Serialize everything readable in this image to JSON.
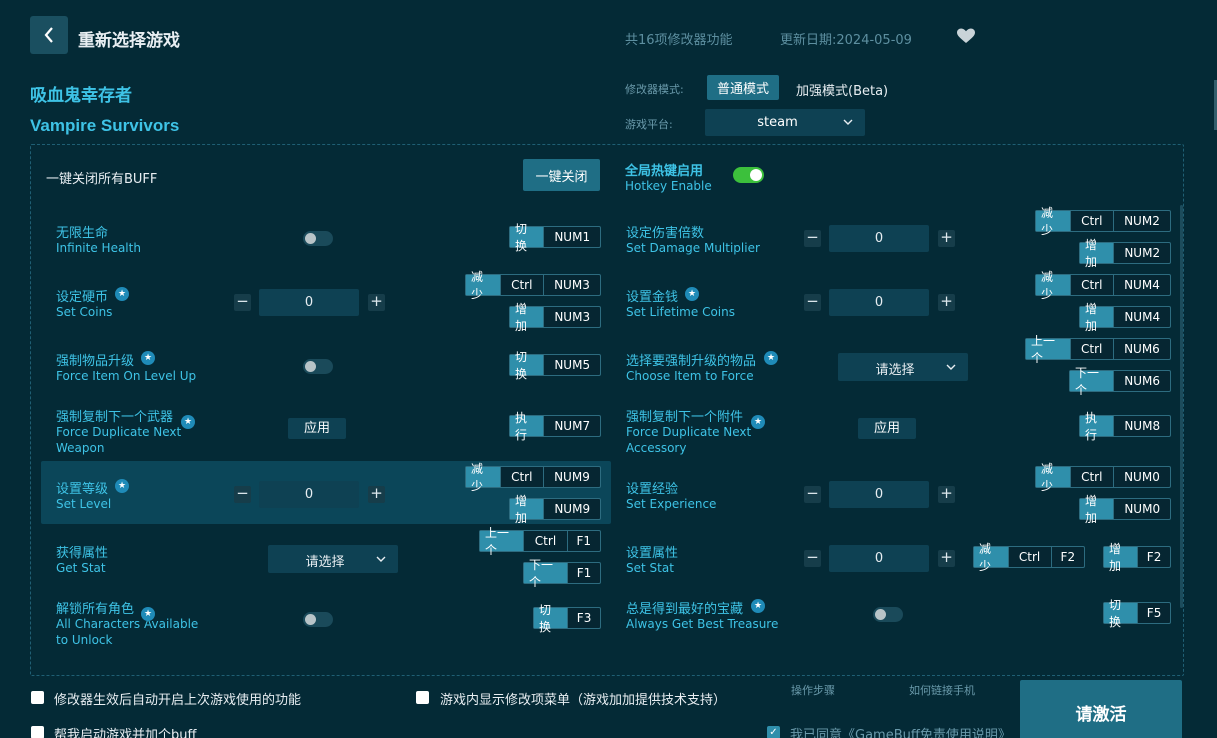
{
  "header": {
    "title": "重新选择游戏",
    "feature_count": "共16项修改器功能",
    "update_date": "更新日期:2024-05-09"
  },
  "game": {
    "name_cn": "吸血鬼幸存者",
    "name_en": "Vampire Survivors"
  },
  "mode": {
    "label": "修改器模式:",
    "normal": "普通模式",
    "strong": "加强模式(Beta)"
  },
  "platform": {
    "label": "游戏平台:",
    "value": "steam"
  },
  "panel": {
    "close_all_label": "一键关闭所有BUFF",
    "close_all_button": "一键关闭",
    "hotkey_cn": "全局热键启用",
    "hotkey_en": "Hotkey Enable"
  },
  "features": [
    {
      "cn": "无限生命",
      "en": "Infinite Health",
      "control": "toggle",
      "keys": [
        [
          "切换",
          "NUM1"
        ]
      ]
    },
    {
      "cn": "设定伤害倍数",
      "en": "Set Damage Multiplier",
      "control": "number",
      "value": "0",
      "keys": [
        [
          "减少",
          "Ctrl",
          "NUM2"
        ],
        [
          "增加",
          "NUM2"
        ]
      ]
    },
    {
      "cn": "设定硬币",
      "en": "Set Coins",
      "star": true,
      "control": "number",
      "value": "0",
      "keys": [
        [
          "减少",
          "Ctrl",
          "NUM3"
        ],
        [
          "增加",
          "NUM3"
        ]
      ]
    },
    {
      "cn": "设置金钱",
      "en": "Set Lifetime Coins",
      "star": true,
      "control": "number",
      "value": "0",
      "keys": [
        [
          "减少",
          "Ctrl",
          "NUM4"
        ],
        [
          "增加",
          "NUM4"
        ]
      ]
    },
    {
      "cn": "强制物品升级",
      "en": "Force Item On Level Up",
      "star": true,
      "control": "toggle",
      "keys": [
        [
          "切换",
          "NUM5"
        ]
      ]
    },
    {
      "cn": "选择要强制升级的物品",
      "en": "Choose Item to Force",
      "star": true,
      "control": "select",
      "value": "请选择",
      "keys": [
        [
          "上一个",
          "Ctrl",
          "NUM6"
        ],
        [
          "下一个",
          "NUM6"
        ]
      ]
    },
    {
      "cn": "强制复制下一个武器",
      "en": "Force Duplicate Next Weapon",
      "star": true,
      "control": "apply",
      "value": "应用",
      "keys": [
        [
          "执行",
          "NUM7"
        ]
      ]
    },
    {
      "cn": "强制复制下一个附件",
      "en": "Force Duplicate Next Accessory",
      "star": true,
      "control": "apply",
      "value": "应用",
      "keys": [
        [
          "执行",
          "NUM8"
        ]
      ]
    },
    {
      "cn": "设置等级",
      "en": "Set Level",
      "star": true,
      "control": "number",
      "value": "0",
      "keys": [
        [
          "减少",
          "Ctrl",
          "NUM9"
        ],
        [
          "增加",
          "NUM9"
        ]
      ]
    },
    {
      "cn": "设置经验",
      "en": "Set Experience",
      "control": "number",
      "value": "0",
      "keys": [
        [
          "减少",
          "Ctrl",
          "NUM0"
        ],
        [
          "增加",
          "NUM0"
        ]
      ]
    },
    {
      "cn": "获得属性",
      "en": "Get Stat",
      "control": "select",
      "value": "请选择",
      "keys": [
        [
          "上一个",
          "Ctrl",
          "F1"
        ],
        [
          "下一个",
          "F1"
        ]
      ]
    },
    {
      "cn": "设置属性",
      "en": "Set Stat",
      "control": "number",
      "value": "0",
      "keys": [
        [
          "减少",
          "Ctrl",
          "F2"
        ],
        [
          "增加",
          "F2"
        ]
      ]
    },
    {
      "cn": "解锁所有角色",
      "en": "All Characters Available to Unlock",
      "star": true,
      "control": "toggle",
      "keys": [
        [
          "切换",
          "F3"
        ]
      ]
    },
    {
      "cn": "总是得到最好的宝藏",
      "en": "Always Get Best Treasure",
      "star": true,
      "control": "toggle",
      "keys": [
        [
          "切换",
          "F5"
        ]
      ]
    }
  ],
  "footer": {
    "auto_enable": "修改器生效后自动开启上次游戏使用的功能",
    "ingame_menu": "游戏内显示修改项菜单（游戏加加提供技术支持）",
    "launch_buff": "帮我启动游戏并加个buff",
    "steps_link": "操作步骤",
    "phone_link": "如何链接手机",
    "agree": "我已同意《GameBuff免责使用说明》",
    "activate": "请激活"
  },
  "icons": {
    "back": "back-arrow-icon",
    "favorite": "heart-icon",
    "star": "star-icon",
    "dropdown": "chevron-down-icon"
  },
  "colors": {
    "accent": "#3ec3e6",
    "background": "#042a36",
    "toggle_on": "#3cc03c",
    "button": "#1f6e85"
  }
}
